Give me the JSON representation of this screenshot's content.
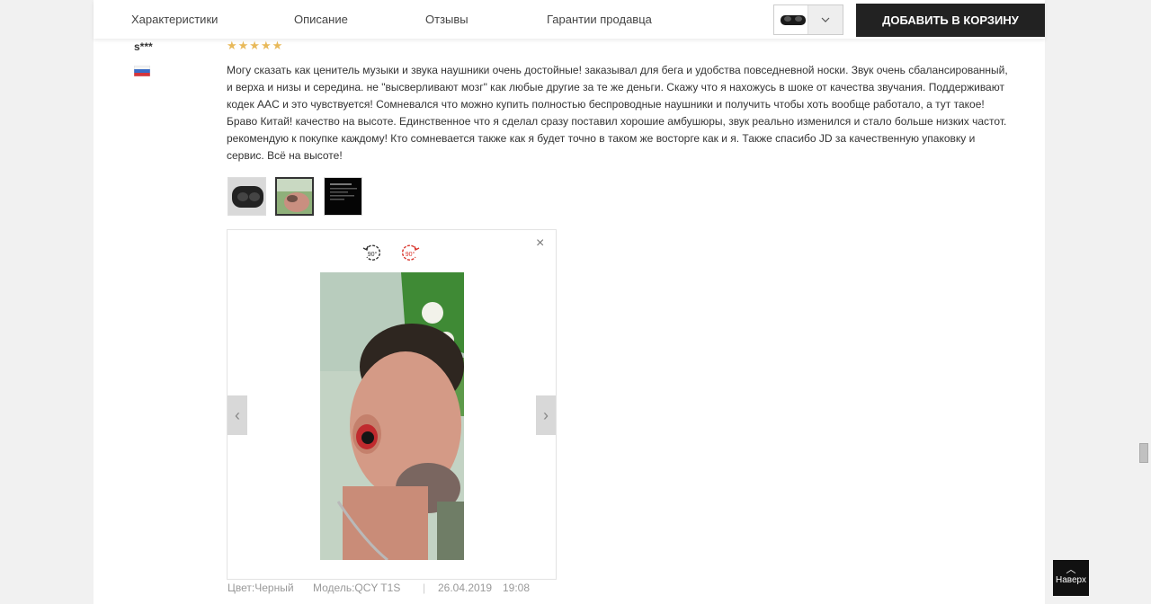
{
  "nav": {
    "tabs": [
      {
        "label": "Характеристики"
      },
      {
        "label": "Описание"
      },
      {
        "label": "Отзывы"
      },
      {
        "label": "Гарантии продавца"
      }
    ],
    "add_to_cart": "ДОБАВИТЬ В КОРЗИНУ",
    "variant_arrow_icon": "chevron-down-icon"
  },
  "review": {
    "username": "s***",
    "country_flag": "russia-flag-icon",
    "rating": 5,
    "stars": "★★★★★",
    "text": "Могу сказать как ценитель музыки и звука наушники очень достойные! заказывал для бега и удобства повседневной носки. Звук очень сбалансированный, и верха и низы и середина. не \"высверливают мозг\" как любые другие за те же деньги. Скажу что я нахожусь в шоке от качества звучания. Поддерживают кодек AAC и это чувствуется! Сомневался что можно купить полностью беспроводные наушники и получить чтобы хоть вообще работало, а тут такое! Браво Китай! качество на высоте. Единственное что я сделал сразу поставил хорошие амбушюры, звук реально изменился и стало больше низких частот. рекомендую к покупке каждому! Кто сомневается также как я будет точно в таком же восторге как и я. Также спасибо JD за качественную упаковку и сервис. Всё на высоте!",
    "color": "Цвет:Черный",
    "model": "Модель:QCY T1S",
    "separator": "|",
    "date": "26.04.2019",
    "time": "19:08"
  },
  "viewer": {
    "rotate_left_label": "90°",
    "rotate_right_label": "90°",
    "close_glyph": "×",
    "prev_glyph": "‹",
    "next_glyph": "›"
  },
  "back_to_top": {
    "arrow": "︿",
    "label": "Наверх"
  },
  "colors": {
    "cart_button": "#222222",
    "star": "#e8b95a",
    "rotate_right": "#d9342b"
  }
}
